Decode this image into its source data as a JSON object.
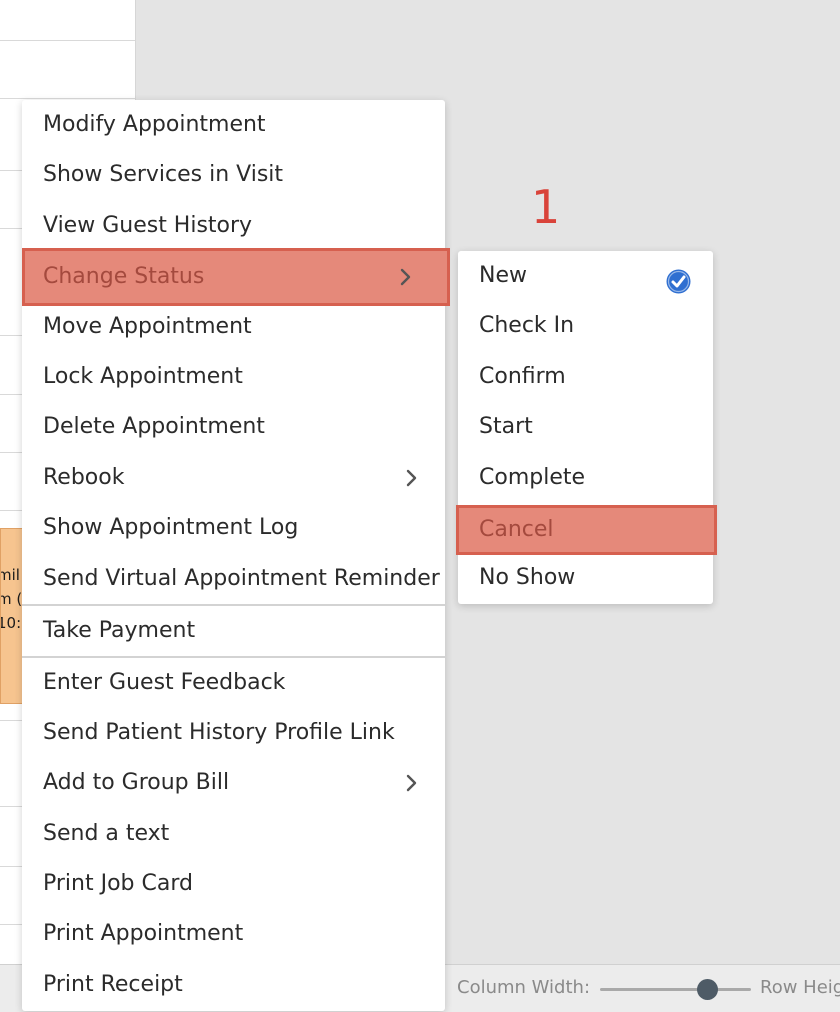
{
  "background": {
    "appointment_lines": [
      "mil",
      "m (",
      "10:"
    ]
  },
  "toolbar": {
    "column_width_label": "Column Width:",
    "row_height_label": "Row Heig",
    "column_width_level": 0.7
  },
  "annotation": {
    "step_number": "1"
  },
  "context_menu": {
    "items": [
      {
        "label": "Modify Appointment"
      },
      {
        "label": "Show Services in Visit"
      },
      {
        "label": "View Guest History"
      },
      {
        "label": "Change Status",
        "submenu": true,
        "highlighted": true
      },
      {
        "label": "Move Appointment"
      },
      {
        "label": "Lock Appointment"
      },
      {
        "label": "Delete Appointment"
      },
      {
        "label": "Rebook",
        "submenu": true
      },
      {
        "label": "Show Appointment Log"
      },
      {
        "label": "Send Virtual Appointment Reminder"
      },
      {
        "label": "Take Payment"
      },
      {
        "label": "Enter Guest Feedback"
      },
      {
        "label": "Send Patient History Profile Link"
      },
      {
        "label": "Add to Group Bill",
        "submenu": true
      },
      {
        "label": "Send a text"
      },
      {
        "label": "Print Job Card"
      },
      {
        "label": "Print Appointment"
      },
      {
        "label": "Print Receipt"
      }
    ]
  },
  "status_submenu": {
    "items": [
      {
        "label": "New",
        "selected": true
      },
      {
        "label": "Check In"
      },
      {
        "label": "Confirm"
      },
      {
        "label": "Start"
      },
      {
        "label": "Complete"
      },
      {
        "label": "Cancel",
        "highlighted": true
      },
      {
        "label": "No Show"
      }
    ]
  },
  "colors": {
    "highlight_fill": "#e5897a",
    "highlight_border": "#d6604f",
    "highlight_text": "#a44a3e",
    "check_blue": "#2f6fd1",
    "annotation_red": "#d9433a"
  }
}
